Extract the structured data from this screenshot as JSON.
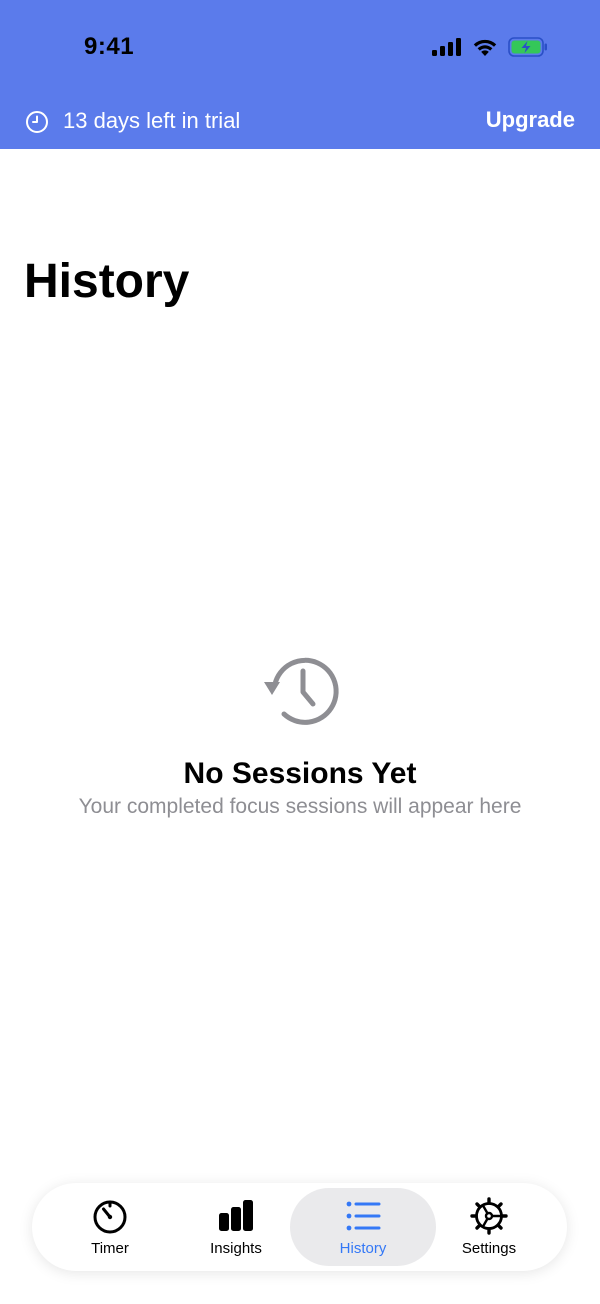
{
  "status_bar": {
    "time": "9:41"
  },
  "trial_banner": {
    "text": "13 days left in trial",
    "upgrade_label": "Upgrade"
  },
  "page": {
    "title": "History"
  },
  "empty_state": {
    "icon": "history-icon",
    "title": "No Sessions Yet",
    "subtitle": "Your completed focus sessions will appear here"
  },
  "tab_bar": {
    "active_tab": "History",
    "tabs": [
      {
        "label": "Timer",
        "icon": "timer-icon"
      },
      {
        "label": "Insights",
        "icon": "bar-chart-icon"
      },
      {
        "label": "History",
        "icon": "list-icon"
      },
      {
        "label": "Settings",
        "icon": "gear-icon"
      }
    ]
  },
  "colors": {
    "header_bg": "#5b7beb",
    "accent": "#3478f6",
    "muted_text": "#8e8e93",
    "battery_fill": "#34c759"
  }
}
